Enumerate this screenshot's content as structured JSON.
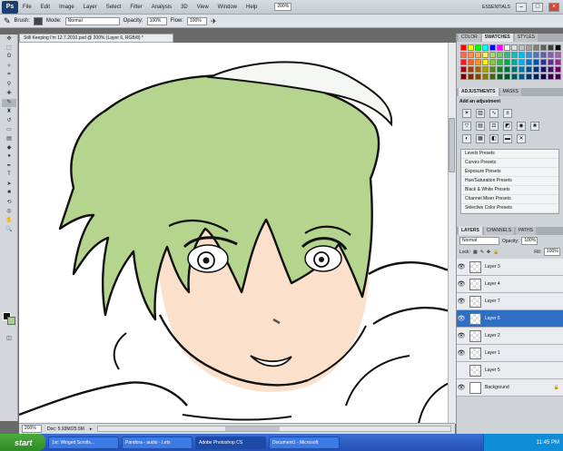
{
  "menubar": {
    "app_logo": "Ps",
    "items": [
      "File",
      "Edit",
      "Image",
      "Layer",
      "Select",
      "Filter",
      "Analysis",
      "3D",
      "View",
      "Window",
      "Help"
    ],
    "zoom": "200%",
    "workspace": "ESSENTIALS"
  },
  "options": {
    "brush_label": "Brush:",
    "mode_label": "Mode:",
    "mode_value": "Normal",
    "opacity_label": "Opacity:",
    "opacity_value": "100%",
    "flow_label": "Flow:",
    "flow_value": "100%"
  },
  "document": {
    "tab_title": "Still Keeping I'm 12.7.2010.psd @ 200% (Layer 6, RGB/8) *",
    "zoom": "200%",
    "doc_info": "Doc: 5.93M/25.5M"
  },
  "panels": {
    "swatch_tabs": [
      "COLOR",
      "SWATCHES",
      "STYLES"
    ],
    "swatch_colors": [
      "#ff0000",
      "#ffff00",
      "#00ff00",
      "#00ffff",
      "#0000ff",
      "#ff00ff",
      "#ffffff",
      "#e0e0e0",
      "#c0c0c0",
      "#a0a0a0",
      "#808080",
      "#606060",
      "#404040",
      "#000000",
      "#f26c4f",
      "#f68e55",
      "#fbaf5c",
      "#fff467",
      "#acd372",
      "#7cc576",
      "#3bb878",
      "#1abbb4",
      "#00bff3",
      "#438ccb",
      "#5574b9",
      "#605ca8",
      "#855fa8",
      "#a763a8",
      "#ed1c24",
      "#f26522",
      "#f7941d",
      "#fff200",
      "#8dc63f",
      "#39b54a",
      "#00a651",
      "#00a99d",
      "#00aeef",
      "#0072bc",
      "#0054a6",
      "#2e3192",
      "#662d91",
      "#92278f",
      "#9e0b0f",
      "#a0410d",
      "#a3620a",
      "#aba000",
      "#598527",
      "#1a7b30",
      "#007236",
      "#00746b",
      "#0076a3",
      "#004b80",
      "#003471",
      "#1b1464",
      "#440e62",
      "#630460",
      "#790000",
      "#7b2e00",
      "#7d4900",
      "#827b00",
      "#406618",
      "#005e20",
      "#005826",
      "#005952",
      "#005b7f",
      "#003663",
      "#002157",
      "#0d004c",
      "#32004b",
      "#4b0049"
    ],
    "adjust_tabs": [
      "ADJUSTMENTS",
      "MASKS"
    ],
    "adjust_title": "Add an adjustment",
    "presets": [
      "Levels Presets",
      "Curves Presets",
      "Exposure Presets",
      "Hue/Saturation Presets",
      "Black & White Presets",
      "Channel Mixer Presets",
      "Selective Color Presets"
    ],
    "layer_tabs": [
      "LAYERS",
      "CHANNELS",
      "PATHS"
    ],
    "blend_mode": "Normal",
    "opacity_label": "Opacity:",
    "opacity_value": "100%",
    "lock_label": "Lock:",
    "fill_label": "Fill:",
    "fill_value": "100%",
    "layers": [
      {
        "name": "Layer 3",
        "visible": true,
        "selected": false
      },
      {
        "name": "Layer 4",
        "visible": true,
        "selected": false
      },
      {
        "name": "Layer 7",
        "visible": true,
        "selected": false
      },
      {
        "name": "Layer 6",
        "visible": true,
        "selected": true
      },
      {
        "name": "Layer 2",
        "visible": true,
        "selected": false
      },
      {
        "name": "Layer 1",
        "visible": true,
        "selected": false
      },
      {
        "name": "Layer 5",
        "visible": false,
        "selected": false
      },
      {
        "name": "Background",
        "visible": true,
        "selected": false
      }
    ]
  },
  "taskbar": {
    "start": "start",
    "tasks": [
      "1st: Winged Scrolls...",
      "Pandora - audio - Lets",
      "Adobe Photoshop CS",
      "Document1 - Microsoft"
    ],
    "active_index": 2,
    "clock": "11:45 PM"
  },
  "colors": {
    "hair": "#b5d48e",
    "skin": "#fbe1cc",
    "selected_layer": "#2e6fc4",
    "foreground": "#111111",
    "background": "#a8d08d"
  }
}
